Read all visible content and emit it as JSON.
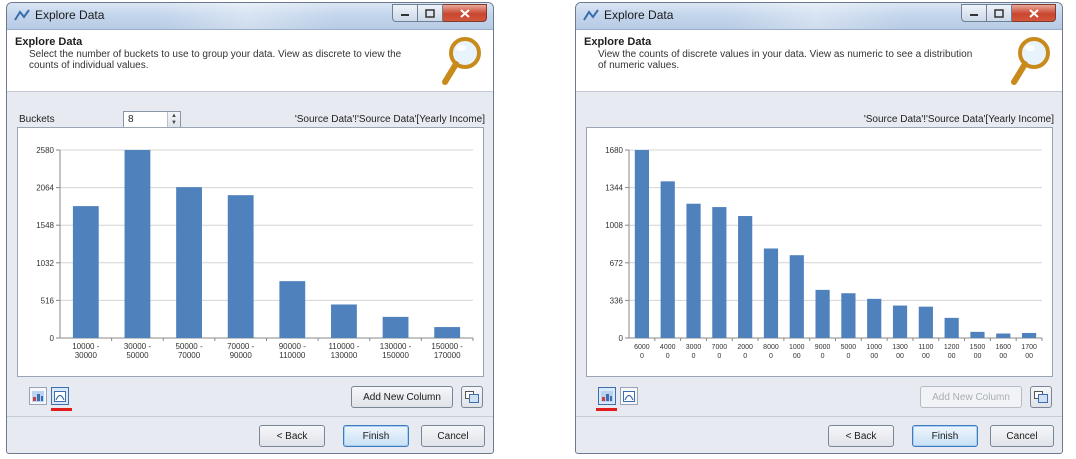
{
  "windows": [
    {
      "title": "Explore Data",
      "header_title": "Explore Data",
      "header_desc": "Select the number of buckets to use to group your data.  View as discrete to view the counts of individual values.",
      "show_buckets": true,
      "buckets_label": "Buckets",
      "buckets_value": "8",
      "source_path": "'Source Data'!'Source Data'[Yearly Income]",
      "add_column_label": "Add New Column",
      "add_column_enabled": true,
      "active_view": "histogram",
      "buttons": {
        "back": "< Back",
        "finish": "Finish",
        "cancel": "Cancel"
      },
      "chart_data": {
        "type": "bar",
        "categories": [
          [
            "10000 -",
            "30000"
          ],
          [
            "30000 -",
            "50000"
          ],
          [
            "50000 -",
            "70000"
          ],
          [
            "70000 -",
            "90000"
          ],
          [
            "90000 -",
            "110000"
          ],
          [
            "110000 -",
            "130000"
          ],
          [
            "130000 -",
            "150000"
          ],
          [
            "150000 -",
            "170000"
          ]
        ],
        "values": [
          1810,
          2580,
          2070,
          1960,
          780,
          460,
          290,
          150
        ],
        "yticks": [
          "0",
          "516",
          "1032",
          "1548",
          "2064",
          "2580"
        ],
        "ylim": [
          0,
          2580
        ],
        "bar_color": "#4f81bd",
        "grid": true
      }
    },
    {
      "title": "Explore Data",
      "header_title": "Explore Data",
      "header_desc": "View the counts of discrete values in your data.  View as numeric to see a distribution of numeric values.",
      "show_buckets": false,
      "source_path": "'Source Data'!'Source Data'[Yearly Income]",
      "add_column_label": "Add New Column",
      "add_column_enabled": false,
      "active_view": "discrete",
      "buttons": {
        "back": "< Back",
        "finish": "Finish",
        "cancel": "Cancel"
      },
      "chart_data": {
        "type": "bar",
        "categories": [
          [
            "6000",
            "0"
          ],
          [
            "4000",
            "0"
          ],
          [
            "3000",
            "0"
          ],
          [
            "7000",
            "0"
          ],
          [
            "2000",
            "0"
          ],
          [
            "8000",
            "0"
          ],
          [
            "1000",
            "00"
          ],
          [
            "9000",
            "0"
          ],
          [
            "5000",
            "0"
          ],
          [
            "1000",
            "00"
          ],
          [
            "1300",
            "00"
          ],
          [
            "1100",
            "00"
          ],
          [
            "1200",
            "00"
          ],
          [
            "1500",
            "00"
          ],
          [
            "1600",
            "00"
          ],
          [
            "1700",
            "00"
          ]
        ],
        "values": [
          1680,
          1400,
          1200,
          1170,
          1090,
          800,
          740,
          430,
          400,
          350,
          290,
          280,
          180,
          55,
          40,
          45
        ],
        "yticks": [
          "0",
          "336",
          "672",
          "1008",
          "1344",
          "1680"
        ],
        "ylim": [
          0,
          1680
        ],
        "bar_color": "#4f81bd",
        "grid": true
      }
    }
  ]
}
